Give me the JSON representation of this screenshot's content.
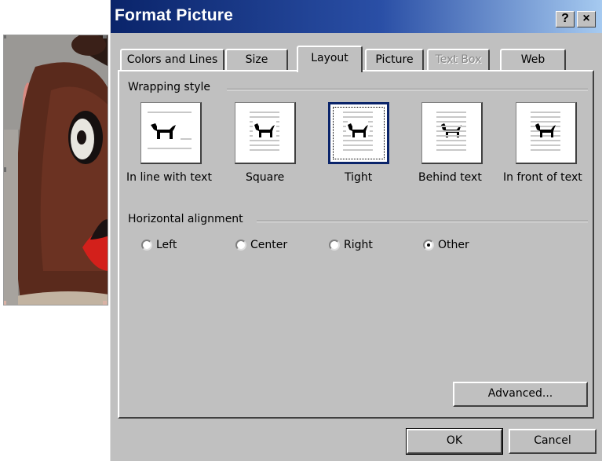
{
  "dialog": {
    "title": "Format Picture",
    "help_glyph": "?",
    "close_glyph": "×"
  },
  "tabs": [
    {
      "label": "Colors and Lines",
      "state": "normal"
    },
    {
      "label": "Size",
      "state": "normal"
    },
    {
      "label": "Layout",
      "state": "active"
    },
    {
      "label": "Picture",
      "state": "normal"
    },
    {
      "label": "Text Box",
      "state": "disabled"
    },
    {
      "label": "Web",
      "state": "normal"
    }
  ],
  "wrapping": {
    "group_label": "Wrapping style",
    "selected": "Tight",
    "options": [
      {
        "label": "In line with text",
        "icon": "in-line-with-text-icon"
      },
      {
        "label": "Square",
        "icon": "square-wrap-icon"
      },
      {
        "label": "Tight",
        "icon": "tight-wrap-icon"
      },
      {
        "label": "Behind text",
        "icon": "behind-text-icon"
      },
      {
        "label": "In front of text",
        "icon": "in-front-of-text-icon"
      }
    ]
  },
  "alignment": {
    "group_label": "Horizontal alignment",
    "selected": "Other",
    "options": [
      {
        "label": "Left"
      },
      {
        "label": "Center"
      },
      {
        "label": "Right"
      },
      {
        "label": "Other"
      }
    ]
  },
  "buttons": {
    "advanced": "Advanced...",
    "ok": "OK",
    "cancel": "Cancel"
  },
  "colors": {
    "title_start": "#0a246a",
    "title_end": "#a6caf0",
    "dialog_bg": "#c0c0c0",
    "selection": "#0a246a"
  }
}
